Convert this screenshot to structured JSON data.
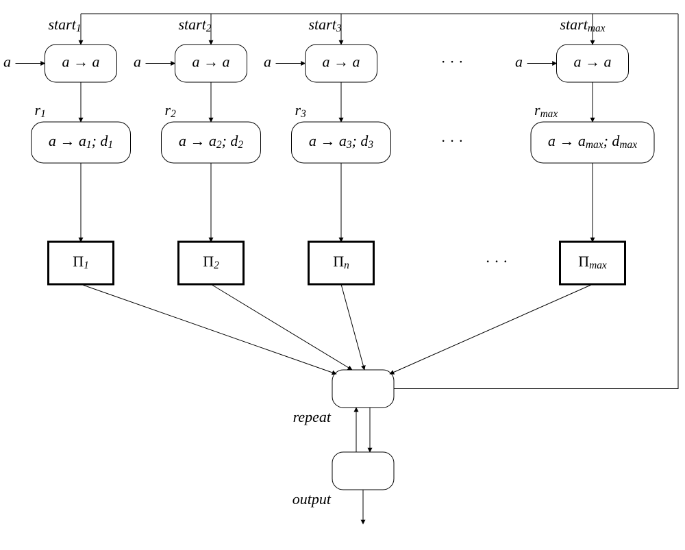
{
  "columns": [
    {
      "start_label": [
        "start",
        "1"
      ],
      "start_rule": "a → a",
      "input_a": "a",
      "r_label": [
        "r",
        "1"
      ],
      "r_rule": [
        "a → a",
        "1",
        "; d",
        "1"
      ],
      "pi": [
        "Π",
        "1"
      ]
    },
    {
      "start_label": [
        "start",
        "2"
      ],
      "start_rule": "a → a",
      "input_a": "a",
      "r_label": [
        "r",
        "2"
      ],
      "r_rule": [
        "a → a",
        "2",
        "; d",
        "2"
      ],
      "pi": [
        "Π",
        "2"
      ]
    },
    {
      "start_label": [
        "start",
        "3"
      ],
      "start_rule": "a → a",
      "input_a": "a",
      "r_label": [
        "r",
        "3"
      ],
      "r_rule": [
        "a → a",
        "3",
        "; d",
        "3"
      ],
      "pi": [
        "Π",
        "n"
      ]
    },
    {
      "start_label": [
        "start",
        "max"
      ],
      "start_rule": "a → a",
      "input_a": "a",
      "r_label": [
        "r",
        "max"
      ],
      "r_rule": [
        "a → a",
        "max",
        "; d",
        "max"
      ],
      "pi": [
        "Π",
        "max"
      ]
    }
  ],
  "dots": "· · ·",
  "repeat_label": "repeat",
  "output_label": "output"
}
